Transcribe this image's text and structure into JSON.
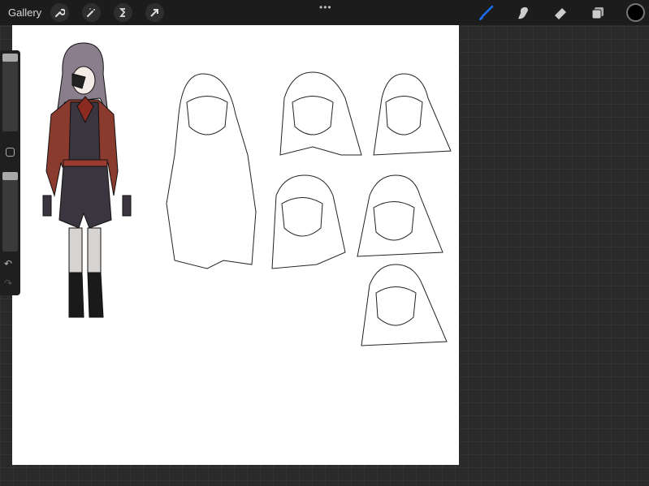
{
  "topbar": {
    "gallery_label": "Gallery",
    "left_tools": [
      "wrench-icon",
      "magic-wand-icon",
      "selection-icon",
      "transform-arrow-icon"
    ],
    "more_label": "•••",
    "right_tools": [
      "brush-icon",
      "smudge-icon",
      "eraser-icon",
      "layers-icon"
    ],
    "active_tool": "brush",
    "active_color": "#1a6ef5",
    "current_color": "#000000"
  },
  "sidebar": {
    "brush_size_percent": 100,
    "opacity_percent": 100,
    "undo_icon": "↶",
    "redo_icon": "↷"
  }
}
